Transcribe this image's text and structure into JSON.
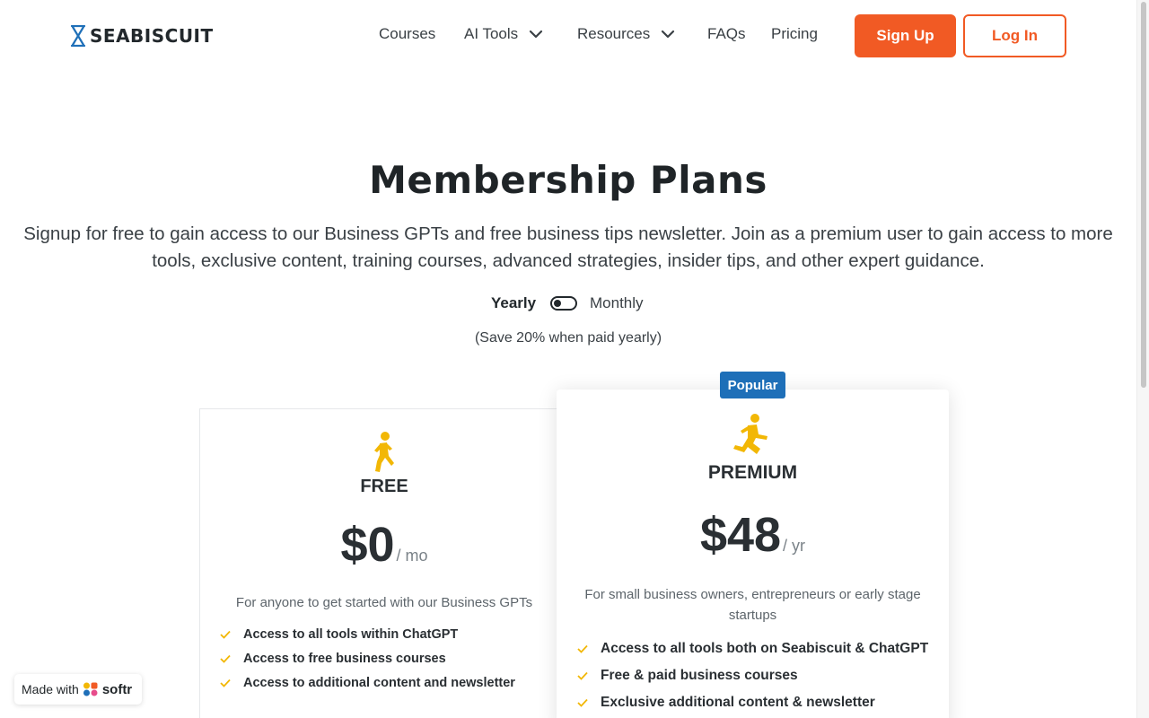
{
  "header": {
    "logo_text": "SEABISCUIT",
    "nav": [
      {
        "label": "Courses",
        "has_dropdown": false
      },
      {
        "label": "AI Tools",
        "has_dropdown": true
      },
      {
        "label": "Resources",
        "has_dropdown": true
      },
      {
        "label": "FAQs",
        "has_dropdown": false
      },
      {
        "label": "Pricing",
        "has_dropdown": false
      }
    ],
    "signup_label": "Sign Up",
    "login_label": "Log In"
  },
  "hero": {
    "title": "Membership Plans",
    "subtitle": "Signup for free to gain access to our Business GPTs and free business tips newsletter. Join as a premium user to gain access to more tools, exclusive content, training courses, advanced strategies, insider tips, and other expert guidance.",
    "toggle": {
      "yearly_label": "Yearly",
      "monthly_label": "Monthly",
      "selected": "Yearly"
    },
    "save_note": "(Save 20% when paid yearly)"
  },
  "plans": [
    {
      "name": "FREE",
      "icon": "walking-person-icon",
      "price": "$0",
      "period": "/ mo",
      "description": "For anyone to get started with our Business GPTs",
      "features": [
        "Access to all tools within ChatGPT",
        "Access to free business courses",
        "Access to additional content and newsletter"
      ]
    },
    {
      "name": "PREMIUM",
      "icon": "running-person-icon",
      "badge": "Popular",
      "price": "$48",
      "period": "/ yr",
      "description": "For small business owners, entrepreneurs or early stage startups",
      "features": [
        "Access to all tools both on Seabiscuit & ChatGPT",
        "Free & paid business courses",
        "Exclusive additional content & newsletter"
      ]
    }
  ],
  "softr_badge": {
    "made_with": "Made with",
    "brand": "softr"
  },
  "colors": {
    "accent": "#f15a24",
    "badge": "#1e6fb8",
    "icon": "#f2b705",
    "check": "#f2b705"
  }
}
